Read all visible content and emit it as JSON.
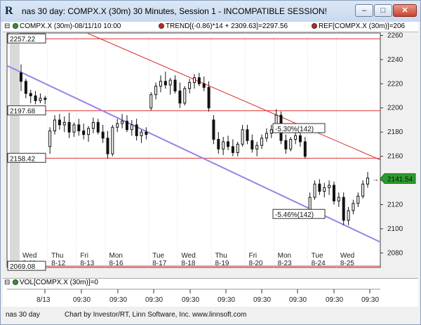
{
  "window": {
    "title": "nas 30 day: COMPX.X (30m) 30 Minutes, Session 1 - INCOMPATIBLE SESSION!",
    "buttons": [
      "–",
      "□",
      "✕"
    ]
  },
  "legend": {
    "series": "COMPX.X (30m)-08/11/10 10:00",
    "trend": "TREND[(-0.86)*14 + 2309.63]=2297.56",
    "ref": "REF[COMPX.X (30m)]=206",
    "time_label": "09:30",
    "colors": {
      "series": "#2d9a2d",
      "trend": "#cc2222",
      "ref": "#cc2222"
    }
  },
  "chart_data": {
    "type": "candlestick",
    "y_ticks": [
      2080,
      2100,
      2120,
      2140,
      2160,
      2180,
      2200,
      2220,
      2240,
      2260
    ],
    "ylim": [
      2068,
      2262
    ],
    "days": [
      {
        "dow": "Wed",
        "date": "8-11"
      },
      {
        "dow": "Thu",
        "date": "8-12"
      },
      {
        "dow": "Fri",
        "date": "8-13"
      },
      {
        "dow": "Mon",
        "date": "8-16"
      },
      {
        "dow": "Tue",
        "date": "8-17"
      },
      {
        "dow": "Wed",
        "date": "8-18"
      },
      {
        "dow": "Thu",
        "date": "8-19"
      },
      {
        "dow": "Fri",
        "date": "8-20"
      },
      {
        "dow": "Mon",
        "date": "8-23"
      },
      {
        "dow": "Tue",
        "date": "8-24"
      },
      {
        "dow": "Wed",
        "date": "8-25"
      }
    ],
    "ref_levels": [
      {
        "value": 2257.22,
        "label": "2257.22"
      },
      {
        "value": 2197.68,
        "label": "2197.68"
      },
      {
        "value": 2158.42,
        "label": "2158.42"
      },
      {
        "value": 2069.08,
        "label": "2069.08"
      }
    ],
    "last_price": {
      "value": 2141.54,
      "label": "2141.54",
      "color": "#2d9a2d"
    },
    "trend_upper": {
      "color": "#dd2a2a",
      "annotation": "-5.30%(142)"
    },
    "trend_lower": {
      "color": "#9b82e8",
      "annotation": "-5.46%(142)"
    },
    "candles": [
      [
        2229,
        2236,
        2214,
        2222
      ],
      [
        2222,
        2224,
        2208,
        2212
      ],
      [
        2212,
        2215,
        2204,
        2210
      ],
      [
        2210,
        2214,
        2203,
        2206
      ],
      [
        2206,
        2212,
        2204,
        2208
      ],
      [
        2208,
        2210,
        2203,
        2207
      ],
      [
        2168,
        2184,
        2162,
        2181
      ],
      [
        2181,
        2194,
        2178,
        2190
      ],
      [
        2190,
        2195,
        2182,
        2186
      ],
      [
        2186,
        2193,
        2180,
        2188
      ],
      [
        2188,
        2196,
        2175,
        2180
      ],
      [
        2180,
        2188,
        2176,
        2186
      ],
      [
        2186,
        2191,
        2177,
        2181
      ],
      [
        2181,
        2187,
        2174,
        2178
      ],
      [
        2178,
        2185,
        2172,
        2183
      ],
      [
        2183,
        2192,
        2179,
        2188
      ],
      [
        2188,
        2191,
        2178,
        2180
      ],
      [
        2180,
        2186,
        2171,
        2175
      ],
      [
        2175,
        2181,
        2158,
        2162
      ],
      [
        2162,
        2186,
        2160,
        2184
      ],
      [
        2184,
        2191,
        2180,
        2187
      ],
      [
        2187,
        2195,
        2183,
        2189
      ],
      [
        2189,
        2194,
        2180,
        2182
      ],
      [
        2182,
        2190,
        2177,
        2186
      ],
      [
        2186,
        2191,
        2173,
        2177
      ],
      [
        2177,
        2182,
        2171,
        2180
      ],
      [
        2180,
        2184,
        2174,
        2178
      ],
      [
        2200,
        2213,
        2198,
        2211
      ],
      [
        2211,
        2221,
        2207,
        2218
      ],
      [
        2218,
        2227,
        2213,
        2222
      ],
      [
        2222,
        2230,
        2216,
        2219
      ],
      [
        2219,
        2225,
        2211,
        2223
      ],
      [
        2223,
        2227,
        2212,
        2214
      ],
      [
        2214,
        2221,
        2200,
        2204
      ],
      [
        2204,
        2218,
        2202,
        2216
      ],
      [
        2216,
        2224,
        2212,
        2221
      ],
      [
        2221,
        2228,
        2216,
        2225
      ],
      [
        2225,
        2229,
        2218,
        2220
      ],
      [
        2220,
        2226,
        2214,
        2217
      ],
      [
        2217,
        2222,
        2197,
        2200
      ],
      [
        2190,
        2194,
        2170,
        2174
      ],
      [
        2174,
        2180,
        2162,
        2166
      ],
      [
        2166,
        2176,
        2161,
        2172
      ],
      [
        2172,
        2177,
        2165,
        2168
      ],
      [
        2168,
        2174,
        2160,
        2163
      ],
      [
        2163,
        2172,
        2160,
        2170
      ],
      [
        2170,
        2186,
        2168,
        2182
      ],
      [
        2182,
        2186,
        2170,
        2173
      ],
      [
        2173,
        2178,
        2163,
        2166
      ],
      [
        2166,
        2172,
        2160,
        2169
      ],
      [
        2169,
        2178,
        2166,
        2175
      ],
      [
        2175,
        2183,
        2172,
        2179
      ],
      [
        2179,
        2186,
        2175,
        2182
      ],
      [
        2182,
        2199,
        2180,
        2194
      ],
      [
        2194,
        2197,
        2170,
        2173
      ],
      [
        2173,
        2178,
        2162,
        2166
      ],
      [
        2166,
        2176,
        2164,
        2174
      ],
      [
        2174,
        2180,
        2170,
        2177
      ],
      [
        2177,
        2180,
        2168,
        2172
      ],
      [
        2172,
        2176,
        2158,
        2160
      ],
      [
        2116,
        2130,
        2114,
        2126
      ],
      [
        2126,
        2140,
        2124,
        2137
      ],
      [
        2137,
        2141,
        2128,
        2131
      ],
      [
        2131,
        2138,
        2126,
        2134
      ],
      [
        2134,
        2140,
        2128,
        2136
      ],
      [
        2136,
        2139,
        2120,
        2123
      ],
      [
        2123,
        2130,
        2118,
        2126
      ],
      [
        2126,
        2130,
        2103,
        2107
      ],
      [
        2107,
        2118,
        2103,
        2115
      ],
      [
        2115,
        2124,
        2112,
        2121
      ],
      [
        2121,
        2130,
        2118,
        2127
      ],
      [
        2127,
        2140,
        2125,
        2137
      ],
      [
        2137,
        2147,
        2134,
        2142
      ]
    ]
  },
  "volume": {
    "label": "VOL[COMPX.X (30m)]=0",
    "color": "#2d9a2d"
  },
  "x_time_labels": [
    "8/13",
    "09:30",
    "09:30",
    "09:30",
    "09:30",
    "09:30",
    "09:30",
    "09:30",
    "09:30",
    "09:30"
  ],
  "status": {
    "chart_name": "nas 30 day",
    "credit": "Chart by Investor/RT, Linn Software, Inc. www.linnsoft.com"
  }
}
